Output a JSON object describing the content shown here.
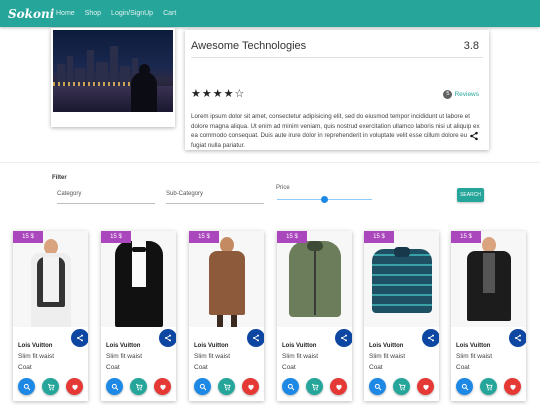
{
  "nav": {
    "brand": "Sokoni",
    "links": [
      "Home",
      "Shop",
      "Login/SignUp",
      "Cart"
    ]
  },
  "product": {
    "title": "Awesome Technologies",
    "rating": "3.8",
    "stars_filled": 4,
    "stars_total": 5,
    "review_count": "5",
    "reviews_label": "Reviews",
    "description": "Lorem ipsum dolor sit amet, consectetur adipisicing elit, sed do eiusmod tempor incididunt ut labore et dolore magna aliqua. Ut enim ad minim veniam, quis nostrud exercitation ullamco laboris nisi ut aliquip ex ea commodo consequat. Duis aute irure dolor in reprehenderit in voluptate velit esse cillum dolore eu fugiat nulla pariatur.",
    "stars_text": "★★★★☆"
  },
  "filter": {
    "label": "Filter",
    "category": "Category",
    "subcategory": "Sub-Category",
    "price": "Price",
    "search": "SEARCH",
    "price_slider_fraction": 0.5
  },
  "cards": [
    {
      "price": "15 $",
      "brand": "Lois Vuitton",
      "line1": "Slim fit waist",
      "line2": "Coat"
    },
    {
      "price": "15 $",
      "brand": "Lois Vuitton",
      "line1": "Slim fit waist",
      "line2": "Coat"
    },
    {
      "price": "15 $",
      "brand": "Lois Vuitton",
      "line1": "Slim fit waist",
      "line2": "Coat"
    },
    {
      "price": "15 $",
      "brand": "Lois Vuitton",
      "line1": "Slim fit waist",
      "line2": "Coat"
    },
    {
      "price": "15 $",
      "brand": "Lois Vuitton",
      "line1": "Slim fit waist",
      "line2": "Coat"
    },
    {
      "price": "15 $",
      "brand": "Lois Vuitton",
      "line1": "Slim fit waist",
      "line2": "Coat"
    }
  ],
  "colors": {
    "primary": "#26a69a",
    "price_tag": "#ab47bc",
    "share": "#0d47a1",
    "search_action": "#1e88e5",
    "cart_action": "#26a69a",
    "wishlist_action": "#e53935"
  }
}
